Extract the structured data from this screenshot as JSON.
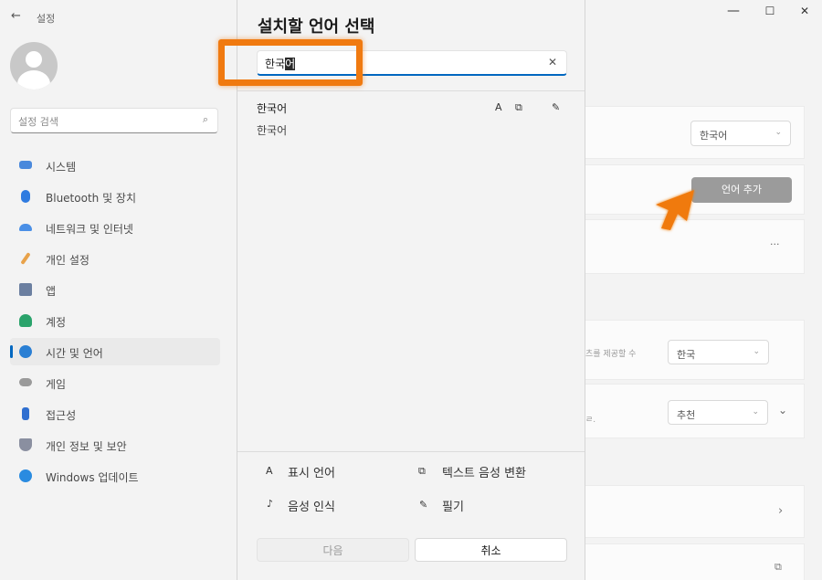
{
  "app": {
    "back_icon": "back-arrow-icon",
    "title": "설정"
  },
  "window_controls": {
    "minimize": "—",
    "maximize": "☐",
    "close": "✕"
  },
  "sidebar": {
    "search_placeholder": "설정 검색",
    "items": [
      {
        "label": "시스템",
        "icon": "system-icon",
        "color": "#4a89dc",
        "active": false
      },
      {
        "label": "Bluetooth 및 장치",
        "icon": "bluetooth-icon",
        "color": "#2f7be0",
        "active": false
      },
      {
        "label": "네트워크 및 인터넷",
        "icon": "network-icon",
        "color": "#4a8fe6",
        "active": false
      },
      {
        "label": "개인 설정",
        "icon": "brush-icon",
        "color": "#e8a24a",
        "active": false
      },
      {
        "label": "앱",
        "icon": "apps-icon",
        "color": "#6b7fa0",
        "active": false
      },
      {
        "label": "계정",
        "icon": "account-icon",
        "color": "#2aa36b",
        "active": false
      },
      {
        "label": "시간 및 언어",
        "icon": "time-language-icon",
        "color": "#2a7fd4",
        "active": true
      },
      {
        "label": "게임",
        "icon": "game-icon",
        "color": "#9a9a9a",
        "active": false
      },
      {
        "label": "접근성",
        "icon": "accessibility-icon",
        "color": "#2f6fd0",
        "active": false
      },
      {
        "label": "개인 정보 및 보안",
        "icon": "shield-icon",
        "color": "#8a8fa0",
        "active": false
      },
      {
        "label": "Windows 업데이트",
        "icon": "update-icon",
        "color": "#2a8be0",
        "active": false
      }
    ]
  },
  "content": {
    "display_language_value": "한국어",
    "add_language_button": "언어 추가",
    "more_options": "···",
    "region_partial": "츠를 제공할 수",
    "region_value": "한국",
    "format_partial": "ㄹ.",
    "format_value": "추천"
  },
  "dialog": {
    "title": "설치할 언어 선택",
    "search_value_plain": "한국",
    "search_value_selected": "어",
    "clear_icon": "✕",
    "result": {
      "name": "한국어",
      "native": "한국어"
    },
    "features": {
      "display_language": "표시 언어",
      "tts": "텍스트 음성 변환",
      "speech": "음성 인식",
      "handwriting": "필기"
    },
    "next_button": "다음",
    "cancel_button": "취소"
  },
  "colors": {
    "accent": "#0067c0",
    "highlight": "#f07a10"
  }
}
